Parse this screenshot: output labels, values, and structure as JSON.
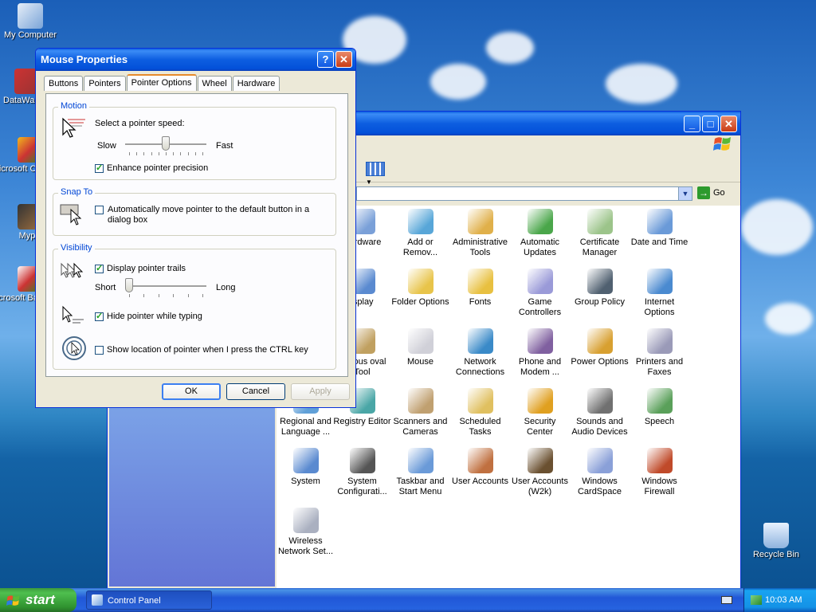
{
  "desktop": {
    "icons": [
      {
        "label": "My Computer"
      },
      {
        "label": "DataWa..."
      },
      {
        "label": "Microsoft C++"
      },
      {
        "label": "Myp"
      },
      {
        "label": "Microsoft Basic"
      },
      {
        "label": "Recycle Bin"
      }
    ]
  },
  "control_panel": {
    "address_go": "Go",
    "items": [
      {
        "label": "Hardware"
      },
      {
        "label": "Add or Remov..."
      },
      {
        "label": "Administrative Tools"
      },
      {
        "label": "Automatic Updates"
      },
      {
        "label": "Certificate Manager"
      },
      {
        "label": "Date and Time"
      },
      {
        "label": "isplay"
      },
      {
        "label": "Folder Options"
      },
      {
        "label": "Fonts"
      },
      {
        "label": "Game Controllers"
      },
      {
        "label": "Group Policy"
      },
      {
        "label": "Internet Options"
      },
      {
        "label": "alicious oval Tool"
      },
      {
        "label": "Mouse"
      },
      {
        "label": "Network Connections"
      },
      {
        "label": "Phone and Modem ..."
      },
      {
        "label": "Power Options"
      },
      {
        "label": "Printers and Faxes"
      },
      {
        "label": "Regional and Language ..."
      },
      {
        "label": "Registry Editor"
      },
      {
        "label": "Scanners and Cameras"
      },
      {
        "label": "Scheduled Tasks"
      },
      {
        "label": "Security Center"
      },
      {
        "label": "Sounds and Audio Devices"
      },
      {
        "label": "Speech"
      },
      {
        "label": "System"
      },
      {
        "label": "System Configurati..."
      },
      {
        "label": "Taskbar and Start Menu"
      },
      {
        "label": "User Accounts"
      },
      {
        "label": "User Accounts (W2k)"
      },
      {
        "label": "Windows CardSpace"
      },
      {
        "label": "Windows Firewall"
      },
      {
        "label": "Wireless Network Set..."
      }
    ]
  },
  "dialog": {
    "title": "Mouse Properties",
    "help_glyph": "?",
    "close_glyph": "✕",
    "tabs": [
      "Buttons",
      "Pointers",
      "Pointer Options",
      "Wheel",
      "Hardware"
    ],
    "active_tab": "Pointer Options",
    "motion": {
      "label": "Motion",
      "speed_prompt": "Select a pointer speed:",
      "slow": "Slow",
      "fast": "Fast",
      "speed_fraction": 0.5,
      "enhance_precision": "Enhance pointer precision",
      "enhance_checked": true
    },
    "snap_to": {
      "label": "Snap To",
      "auto_move": "Automatically move pointer to the default button in a dialog box",
      "auto_move_checked": false
    },
    "visibility": {
      "label": "Visibility",
      "trails": "Display pointer trails",
      "trails_checked": true,
      "short": "Short",
      "long": "Long",
      "trail_fraction": 0.0,
      "hide_typing": "Hide pointer while typing",
      "hide_typing_checked": true,
      "show_location": "Show location of pointer when I press the CTRL key",
      "show_location_checked": false
    },
    "buttons": {
      "ok": "OK",
      "cancel": "Cancel",
      "apply": "Apply"
    }
  },
  "taskbar": {
    "start_label": "start",
    "task": "Control Panel",
    "clock": "10:03 AM"
  },
  "colors": {
    "xp_blue": "#0a5ee0",
    "start_green": "#3c9a3c",
    "group_label": "#0046d5"
  }
}
